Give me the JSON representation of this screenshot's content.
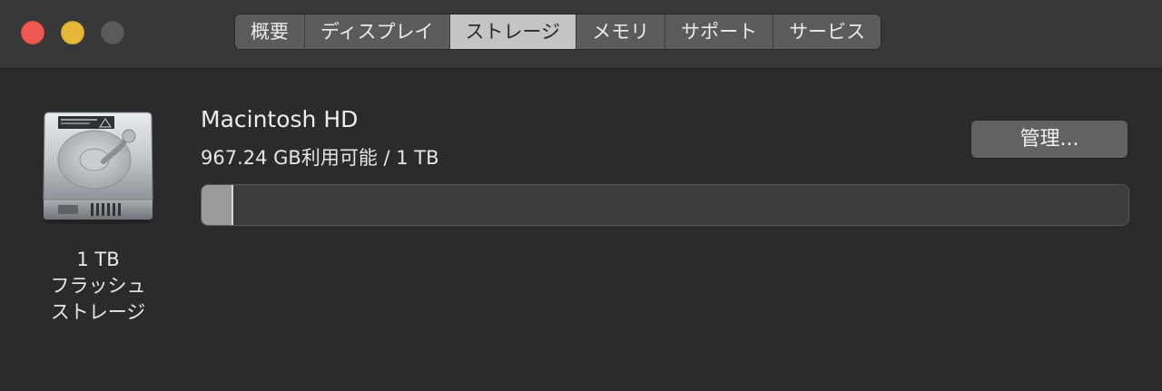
{
  "window": {
    "controls": {
      "close_icon": "close-icon",
      "minimize_icon": "minimize-icon",
      "zoom_icon": "zoom-icon"
    },
    "tabs": [
      {
        "label": "概要",
        "selected": false
      },
      {
        "label": "ディスプレイ",
        "selected": false
      },
      {
        "label": "ストレージ",
        "selected": true
      },
      {
        "label": "メモリ",
        "selected": false
      },
      {
        "label": "サポート",
        "selected": false
      },
      {
        "label": "サービス",
        "selected": false
      }
    ]
  },
  "disk": {
    "icon": "hard-drive-icon",
    "caption_line1": "1 TB",
    "caption_line2": "フラッシュ",
    "caption_line3": "ストレージ"
  },
  "volume": {
    "name": "Macintosh HD",
    "usage_text": "967.24 GB利用可能 / 1 TB",
    "available_gb": 967.24,
    "total_gb": 1000
  },
  "manage_button": {
    "label": "管理..."
  },
  "colors": {
    "window_bg": "#2b2a2d",
    "titlebar_bg": "#38373a",
    "close": "#ee5a52",
    "minimize": "#e6b839",
    "zoom_disabled": "#5b5a5d",
    "tab_selected_bg": "#c4c4c6",
    "used_fill": "#9a9a9c"
  }
}
